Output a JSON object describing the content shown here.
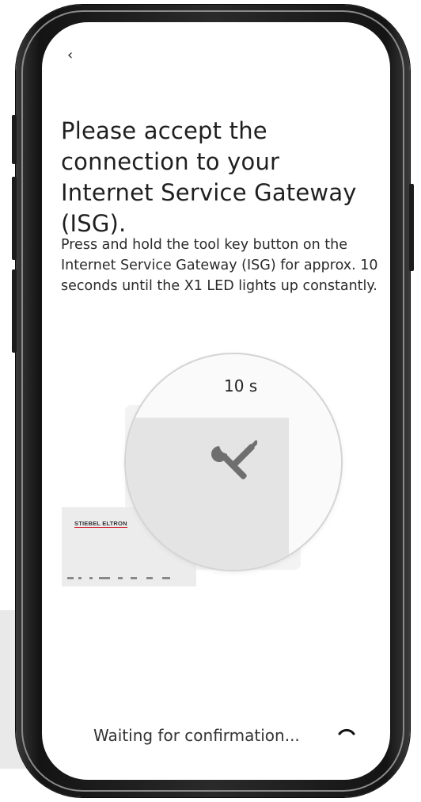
{
  "nav": {
    "back_glyph": "‹"
  },
  "title": "Please accept the connection to your Internet Service Gateway (ISG).",
  "description": "Press and hold the tool key button on the Internet Service Gateway (ISG) for approx. 10 seconds until the X1 LED lights up constantly.",
  "illustration": {
    "timer_label": "10 s",
    "brand_logo": "STIEBEL ELTRON",
    "icon": "wrench-screwdriver-icon"
  },
  "status": {
    "text": "Waiting for confirmation..."
  },
  "colors": {
    "brand_red": "#d21a2a",
    "text": "#1f1f1f",
    "icon_grey": "#6f6f6f"
  }
}
